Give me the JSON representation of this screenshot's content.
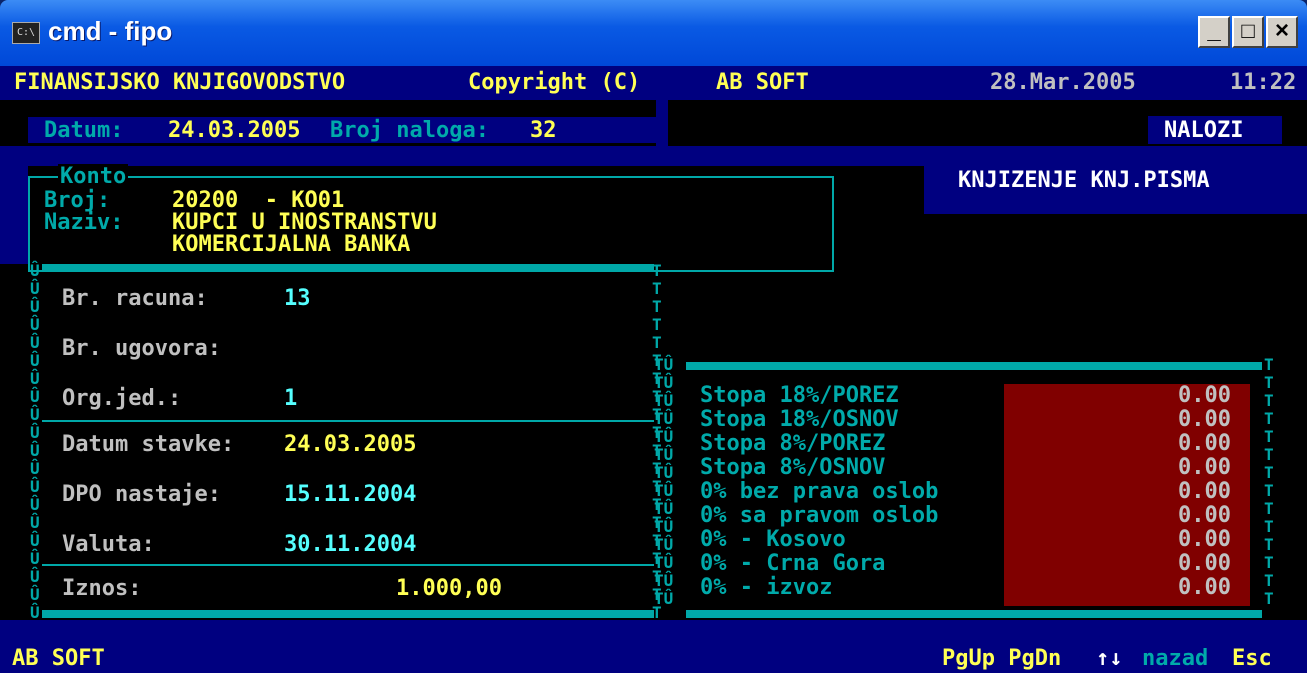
{
  "window": {
    "title": "cmd - fipo",
    "app_icon": "C:\\",
    "minimize": "_",
    "maximize": "□",
    "close": "×"
  },
  "header": {
    "app_name": "FINANSIJSKO KNJIGOVODSTVO",
    "copyright": "Copyright (C)",
    "company": "AB SOFT",
    "date": "28.Mar.2005",
    "time": "11:22"
  },
  "info": {
    "datum_label": "Datum:",
    "datum_value": "24.03.2005",
    "broj_naloga_label": "Broj naloga:",
    "broj_naloga_value": "32",
    "module": "NALOZI",
    "operation": "KNJIZENJE KNJ.PISMA"
  },
  "konto": {
    "title": "Konto",
    "broj_label": "Broj:",
    "broj_value": "20200  - KO01",
    "naziv_label": "Naziv:",
    "naziv_line1": "KUPCI U INOSTRANSTVU",
    "naziv_line2": "KOMERCIJALNA BANKA"
  },
  "form": {
    "racun_label": "Br. racuna:",
    "racun_value": "13",
    "ugovor_label": "Br. ugovora:",
    "ugovor_value": "",
    "orgjed_label": "Org.jed.:",
    "orgjed_value": "1",
    "datum_stavke_label": "Datum stavke:",
    "datum_stavke_value": "24.03.2005",
    "dpo_label": "DPO nastaje:",
    "dpo_value": "15.11.2004",
    "valuta_label": "Valuta:",
    "valuta_value": "30.11.2004",
    "iznos_label": "Iznos:",
    "iznos_value": "1.000,00"
  },
  "tax_rows": [
    {
      "label": "Stopa 18%/POREZ",
      "value": "0.00"
    },
    {
      "label": "Stopa 18%/OSNOV",
      "value": "0.00"
    },
    {
      "label": "Stopa 8%/POREZ",
      "value": "0.00"
    },
    {
      "label": "Stopa 8%/OSNOV",
      "value": "0.00"
    },
    {
      "label": "0% bez prava oslob",
      "value": "0.00"
    },
    {
      "label": "0% sa pravom oslob",
      "value": "0.00"
    },
    {
      "label": "0% - Kosovo",
      "value": "0.00"
    },
    {
      "label": "0% - Crna Gora",
      "value": "0.00"
    },
    {
      "label": "0% - izvoz",
      "value": "0.00"
    }
  ],
  "status": {
    "left": "AB SOFT",
    "keys": "PgUp PgDn",
    "arrows": "↑↓",
    "nazad": "nazad",
    "esc": "Esc"
  },
  "colors": {
    "console_bg": "#000000",
    "bar_blue": "#000080",
    "accent_teal": "#00a8a8",
    "value_yellow": "#ffff55",
    "value_cyan": "#55ffff",
    "tax_box": "#800000"
  }
}
